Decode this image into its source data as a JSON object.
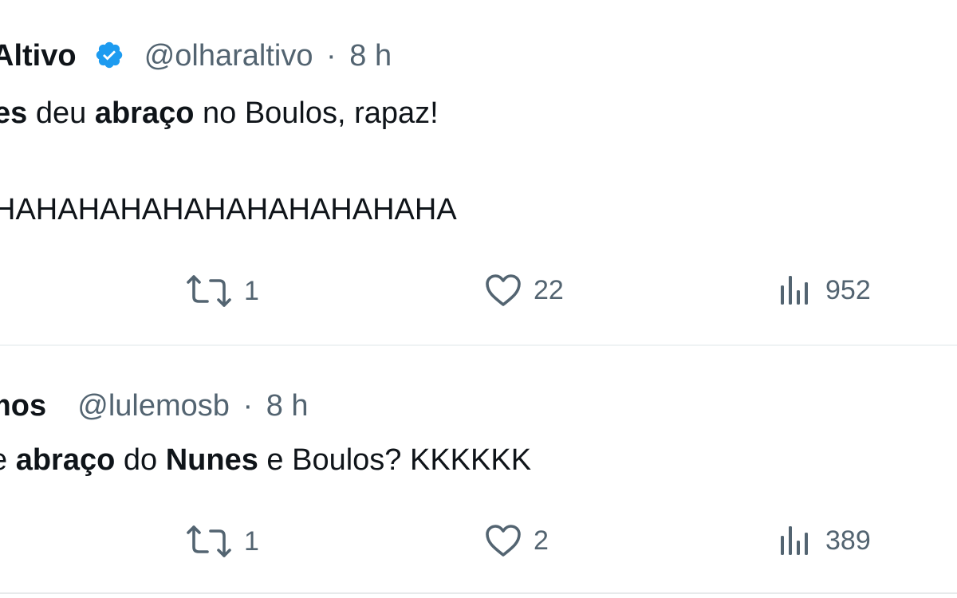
{
  "tweets": [
    {
      "author_name": "Altivo",
      "handle": "@olharaltivo",
      "separator": "·",
      "time": "8 h",
      "text_line1": [
        {
          "t": "es",
          "bold": true
        },
        {
          "t": " deu ",
          "bold": false
        },
        {
          "t": "abraço",
          "bold": true
        },
        {
          "t": " no Boulos, rapaz!",
          "bold": false
        }
      ],
      "text_line2": "HAHAHAHAHAHAHAHAHAHAHA",
      "retweets": "1",
      "likes": "22",
      "views": "952"
    },
    {
      "author_name": "mos",
      "handle": "@lulemosb",
      "separator": "·",
      "time": "8 h",
      "text_line1": [
        {
          "t": "e ",
          "bold": false
        },
        {
          "t": "abraço",
          "bold": true
        },
        {
          "t": " do ",
          "bold": false
        },
        {
          "t": "Nunes",
          "bold": true
        },
        {
          "t": " e Boulos? KKKKKK",
          "bold": false
        }
      ],
      "retweets": "1",
      "likes": "2",
      "views": "389"
    }
  ],
  "icons": {
    "verified": "verified-badge-icon",
    "retweet": "retweet-icon",
    "like": "heart-icon",
    "views": "views-chart-icon"
  },
  "colors": {
    "text": "#0f1419",
    "secondary": "#536471",
    "verified": "#1d9bf0",
    "divider": "#eff3f4"
  }
}
